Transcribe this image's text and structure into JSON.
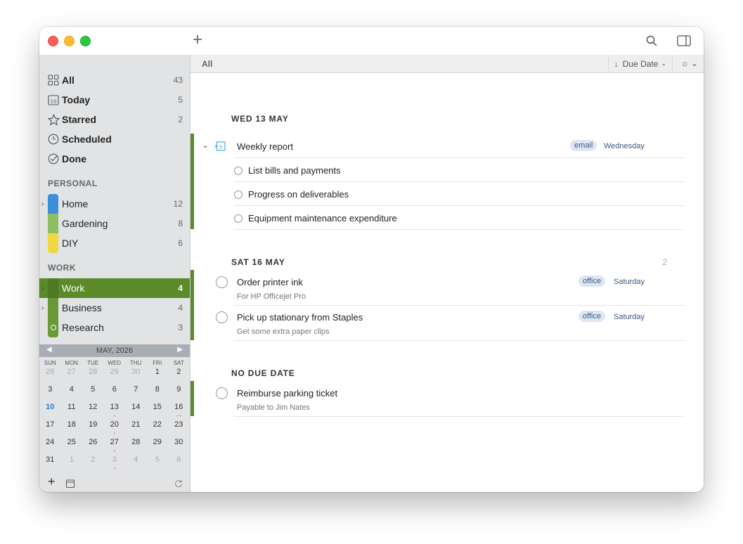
{
  "toolbar": {
    "add_icon": "plus-icon",
    "search_icon": "search-icon",
    "panel_icon": "sidebar-toggle-icon"
  },
  "sidebar": {
    "smart": [
      {
        "label": "All",
        "count": "43",
        "icon": "grid-icon"
      },
      {
        "label": "Today",
        "count": "5",
        "icon": "calendar-icon"
      },
      {
        "label": "Starred",
        "count": "2",
        "icon": "star-icon"
      },
      {
        "label": "Scheduled",
        "count": "",
        "icon": "clock-icon"
      },
      {
        "label": "Done",
        "count": "",
        "icon": "check-circle-icon"
      }
    ],
    "personal_header": "PERSONAL",
    "personal": [
      {
        "label": "Home",
        "count": "12",
        "color": "#3b8fd9"
      },
      {
        "label": "Gardening",
        "count": "8",
        "color": "#8cc063"
      },
      {
        "label": "DIY",
        "count": "6",
        "color": "#f0d940"
      }
    ],
    "work_header": "WORK",
    "work": [
      {
        "label": "Work",
        "count": "4",
        "color": "#5b8a2b"
      },
      {
        "label": "Business",
        "count": "4",
        "color": "#6a9a34"
      },
      {
        "label": "Research",
        "count": "3",
        "color": "#6a9a34"
      }
    ]
  },
  "calendar": {
    "title": "MAY, 2026",
    "weekdays": [
      "SUN",
      "MON",
      "TUE",
      "WED",
      "THU",
      "FRI",
      "SAT"
    ],
    "rows": [
      [
        "26",
        "27",
        "28",
        "29",
        "30",
        "1",
        "2"
      ],
      [
        "3",
        "4",
        "5",
        "6",
        "7",
        "8",
        "9"
      ],
      [
        "10",
        "11",
        "12",
        "13",
        "14",
        "15",
        "16"
      ],
      [
        "17",
        "18",
        "19",
        "20",
        "21",
        "22",
        "23"
      ],
      [
        "24",
        "25",
        "26",
        "27",
        "28",
        "29",
        "30"
      ],
      [
        "31",
        "1",
        "2",
        "3",
        "4",
        "5",
        "6"
      ]
    ],
    "today": "10"
  },
  "main": {
    "title": "All",
    "sort_label": "Due Date",
    "groups": [
      {
        "header": "WED 13 MAY",
        "count": ""
      },
      {
        "header": "SAT 16 MAY",
        "count": "2"
      },
      {
        "header": "NO DUE DATE",
        "count": ""
      }
    ],
    "tasks": {
      "weekly": {
        "title": "Weekly report",
        "tag": "email",
        "when": "Wednesday"
      },
      "sub1": "List bills and payments",
      "sub2": "Progress on deliverables",
      "sub3": "Equipment maintenance expenditure",
      "ink": {
        "title": "Order printer ink",
        "note": "For HP Officejet Pro",
        "tag": "office",
        "when": "Saturday"
      },
      "staples": {
        "title": "Pick up stationary from Staples",
        "note": "Get some extra paper clips",
        "tag": "office",
        "when": "Saturday"
      },
      "parking": {
        "title": "Reimburse parking ticket",
        "note": "Payable to Jim Nates"
      }
    }
  }
}
